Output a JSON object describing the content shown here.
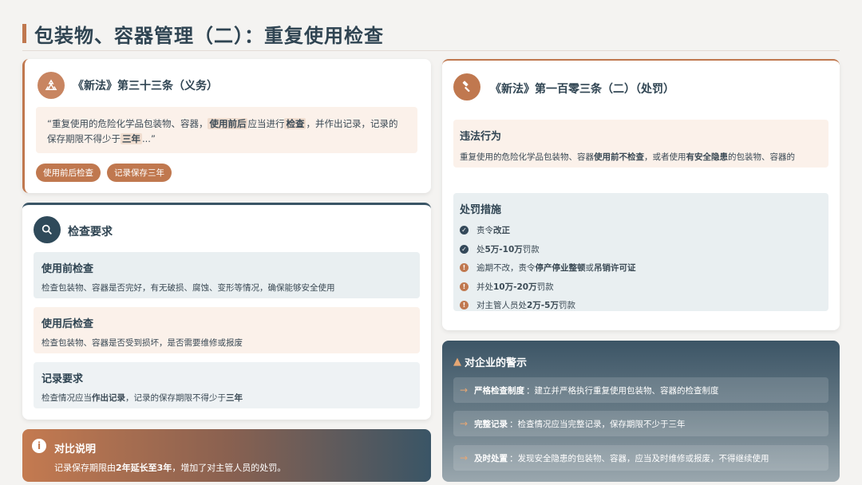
{
  "page": {
    "title": "包装物、容器管理（二）：重复使用检查"
  },
  "article33": {
    "title": "《新法》第三十三条（义务）",
    "icon": "recycle-icon",
    "quote": {
      "p1": "“重复使用的危险化学品包装物、容器，",
      "h1": "使用前后",
      "p2": "应当进行",
      "h2": "检查",
      "p3": "，并作出记录，记录的保存期限不得少于",
      "h3": "三年",
      "p4": "...”"
    },
    "tags": [
      "使用前后检查",
      "记录保存三年"
    ]
  },
  "inspection": {
    "title": "检查要求",
    "icon": "search-icon",
    "items": [
      {
        "heading": "使用前检查",
        "text": "检查包装物、容器是否完好，有无破损、腐蚀、变形等情况，确保能够安全使用"
      },
      {
        "heading": "使用后检查",
        "text": "检查包装物、容器是否受到损坏，是否需要维修或报废"
      },
      {
        "heading": "记录要求",
        "t1": "检查情况应当",
        "b1": "作出记录",
        "t2": "，记录的保存期限不得少于",
        "b2": "三年"
      }
    ]
  },
  "comparison": {
    "title": "对比说明",
    "icon": "info-icon",
    "t1": "记录保存期限由",
    "b1": "2年延长至3年",
    "t2": "，增加了对主管人员的处罚。"
  },
  "article103": {
    "title": "《新法》第一百零三条（二）（处罚）",
    "icon": "gavel-icon",
    "violation": {
      "heading": "违法行为",
      "t1": "重复使用的危险化学品包装物、容器",
      "b1": "使用前不检查",
      "t2": "，或者使用",
      "b2": "有安全隐患",
      "t3": "的包装物、容器的"
    },
    "penalty": {
      "heading": "处罚措施",
      "items": [
        {
          "type": "check",
          "t1": "责令",
          "b1": "改正",
          "t2": "",
          "b2": "",
          "t3": ""
        },
        {
          "type": "check",
          "t1": "处",
          "b1": "5万-10万",
          "t2": "罚款",
          "b2": "",
          "t3": ""
        },
        {
          "type": "warn",
          "t1": "逾期不改，责令",
          "b1": "停产停业整顿",
          "t2": "或",
          "b2": "吊销许可证",
          "t3": ""
        },
        {
          "type": "warn",
          "t1": "并处",
          "b1": "10万-20万",
          "t2": "罚款",
          "b2": "",
          "t3": ""
        },
        {
          "type": "warn",
          "t1": "对主管人员处",
          "b1": "2万-5万",
          "t2": "罚款",
          "b2": "",
          "t3": ""
        }
      ]
    }
  },
  "warning": {
    "title": "对企业的警示",
    "icon": "warning-icon",
    "items": [
      {
        "label": "严格检查制度",
        "text": "：建立并严格执行重复使用包装物、容器的检查制度"
      },
      {
        "label": "完整记录",
        "text": "：检查情况应当完整记录，保存期限不少于三年"
      },
      {
        "label": "及时处置",
        "text": "：发现安全隐患的包装物、容器，应当及时维修或报废，不得继续使用"
      }
    ]
  },
  "colors": {
    "accent": "#c0784f",
    "navy": "#2f4452",
    "peach_bg": "#fbf1ea",
    "gray_bg": "#e9eff1"
  }
}
